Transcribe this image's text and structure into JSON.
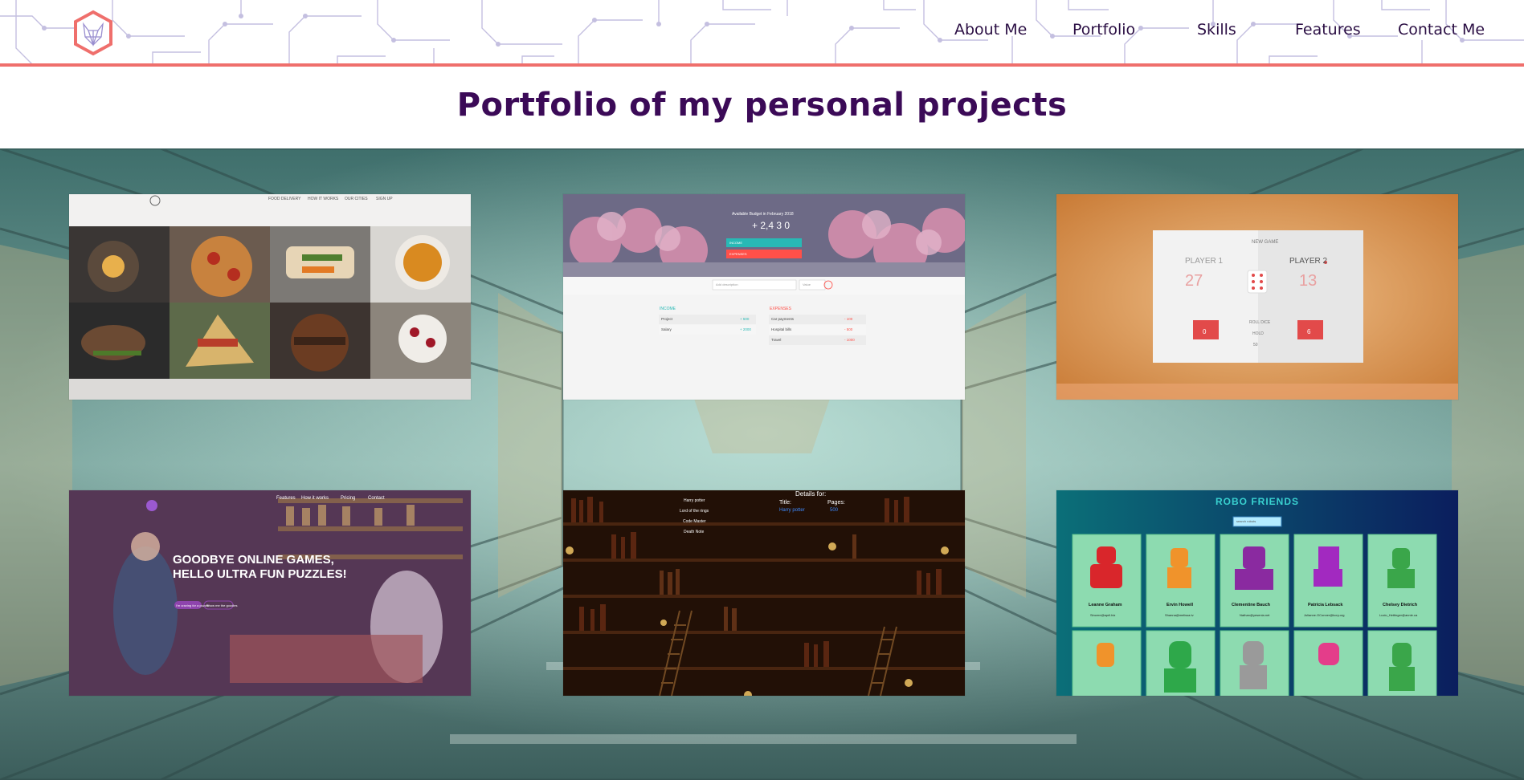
{
  "nav": {
    "logo_icon": "hexagon-fox-logo-icon",
    "links": [
      "About Me",
      "Portfolio",
      "Skills",
      "Features",
      "Contact Me"
    ]
  },
  "page": {
    "title": "Portfolio of my personal projects"
  },
  "colors": {
    "accent_line": "#ef6f6c",
    "nav_text": "#2b0f44",
    "title_text": "#3b0a57",
    "circuit": "#b9b3d6"
  },
  "projects": {
    "food": {
      "nav": [
        "FOOD DELIVERY",
        "HOW IT WORKS",
        "OUR CITIES",
        "SIGN UP"
      ]
    },
    "budget": {
      "header_caption": "Available Budget in February 2018",
      "total": "+ 2,4 3 0",
      "income_bar": "INCOME",
      "expenses_bar": "EXPENSES",
      "input_placeholder": "Add description",
      "value_placeholder": "Value",
      "income_title": "INCOME",
      "expenses_title": "EXPENSES",
      "income_rows": [
        {
          "name": "Project",
          "value": "+ 500"
        },
        {
          "name": "Salary",
          "value": "+ 2000"
        }
      ],
      "expense_rows": [
        {
          "name": "Car payments",
          "value": "- 100"
        },
        {
          "name": "Hospital bills",
          "value": "- 500"
        },
        {
          "name": "Travel",
          "value": "- 1000"
        }
      ]
    },
    "dice": {
      "new_game": "NEW GAME",
      "player1": "PLAYER 1",
      "player2": "PLAYER 2",
      "score1": "27",
      "score2": "13",
      "current1": "0",
      "current2": "6",
      "roll": "ROLL DICE",
      "hold": "HOLD",
      "target": "50"
    },
    "puzzles": {
      "nav": [
        "Features",
        "How it works",
        "Pricing",
        "Contact"
      ],
      "headline_1": "GOODBYE ONLINE GAMES,",
      "headline_2": "HELLO ULTRA FUN PUZZLES!",
      "btn_primary": "I'm craving for a puzzle",
      "btn_secondary": "Show me the goodies"
    },
    "books": {
      "list": [
        "Harry potter",
        "Lord of the rings",
        "Code Master",
        "Death Note"
      ],
      "details_label": "Details for:",
      "title_label": "Title:",
      "pages_label": "Pages:",
      "title_value": "Harry potter",
      "pages_value": "500"
    },
    "robofriends": {
      "title": "ROBO FRIENDS",
      "search_placeholder": "search robots",
      "robots": [
        {
          "name": "Leanne Graham",
          "email": "Sincere@april.biz"
        },
        {
          "name": "Ervin Howell",
          "email": "Shanna@melissa.tv"
        },
        {
          "name": "Clementine Bauch",
          "email": "Nathan@yesenia.net"
        },
        {
          "name": "Patricia Lebsack",
          "email": "Julianne.OConner@kory.org"
        },
        {
          "name": "Chelsey Dietrich",
          "email": "Lucio_Hettinger@annie.ca"
        }
      ]
    }
  }
}
